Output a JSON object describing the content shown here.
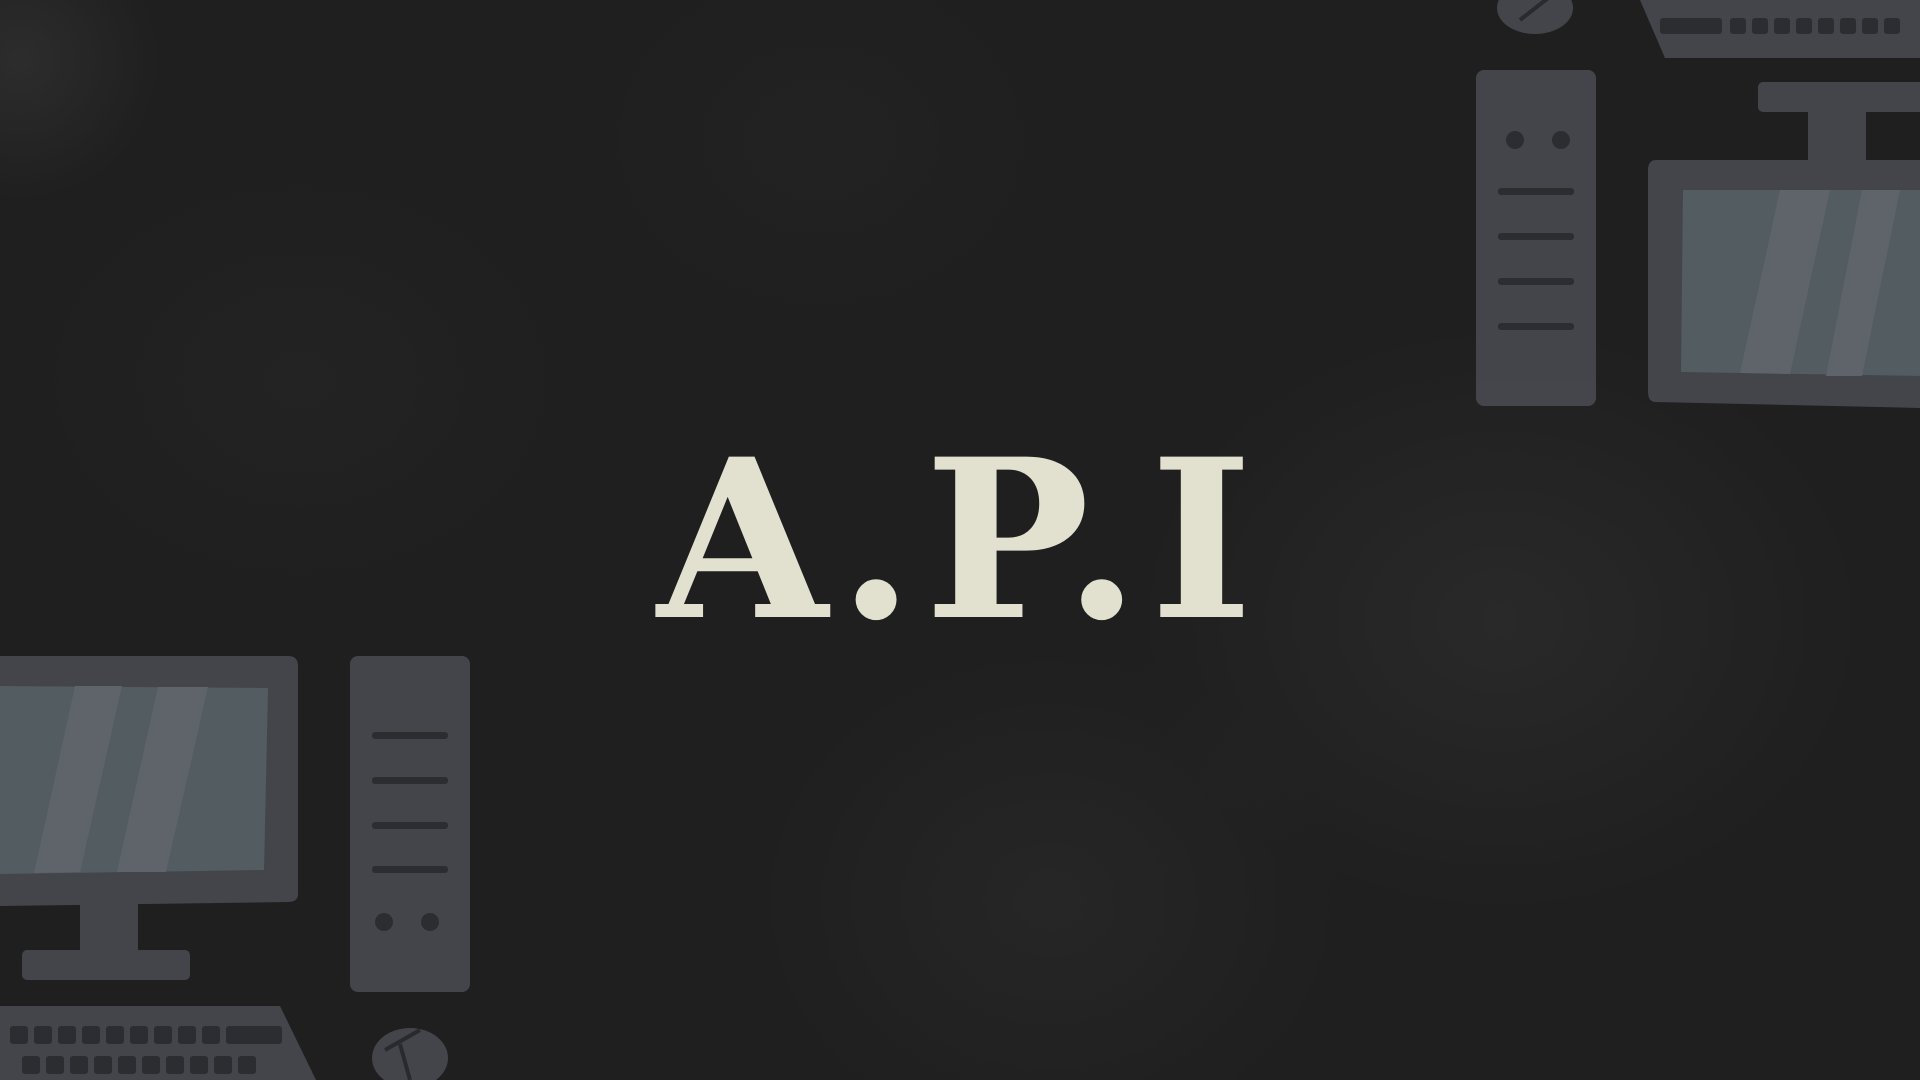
{
  "title": "A.P.I",
  "colors": {
    "background": "#1f1f1f",
    "title": "#e2e0cf",
    "device_body": "#4a4c52",
    "device_screen": "#5d676c"
  },
  "icons": [
    "desktop-computer-icon",
    "tower-case-icon",
    "keyboard-icon",
    "mouse-icon"
  ]
}
